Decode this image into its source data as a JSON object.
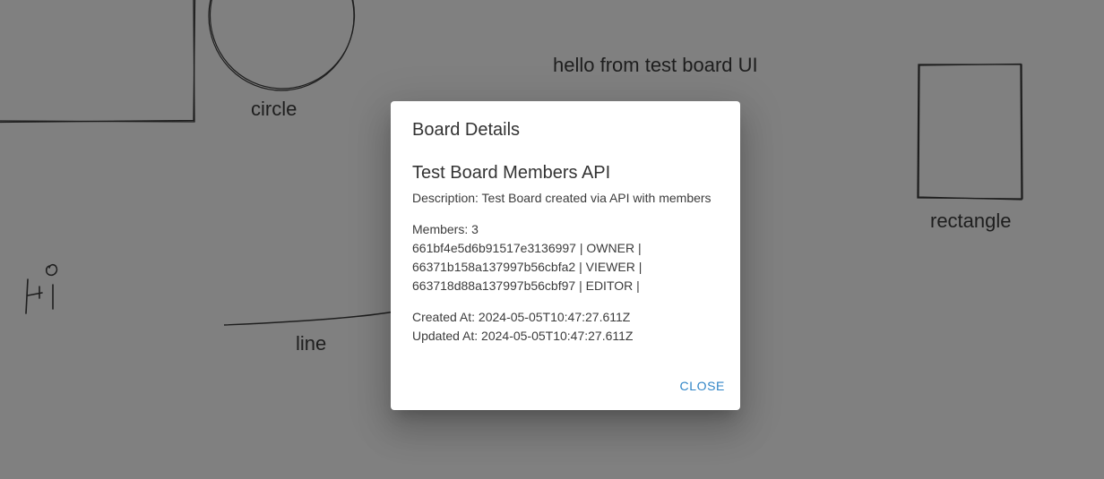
{
  "canvas": {
    "labels": {
      "circle": "circle",
      "rectangle": "rectangle",
      "line": "line",
      "text_element": "hello from test board UI"
    }
  },
  "dialog": {
    "title": "Board Details",
    "board_name": "Test Board Members API",
    "description": "Description: Test Board created via API with members",
    "members_count": "Members: 3",
    "members": [
      "661bf4e5d6b91517e3136997 | OWNER |",
      "66371b158a137997b56cbfa2 | VIEWER |",
      "663718d88a137997b56cbf97 | EDITOR |"
    ],
    "created_at": "Created At: 2024-05-05T10:47:27.611Z",
    "updated_at": "Updated At: 2024-05-05T10:47:27.611Z",
    "close_label": "CLOSE"
  }
}
